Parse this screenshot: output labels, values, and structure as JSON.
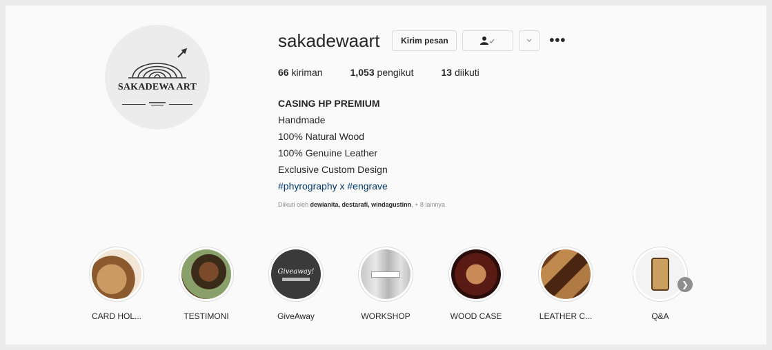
{
  "profile": {
    "username": "sakadewaart",
    "avatar_text": "SAKADEWA ART",
    "buttons": {
      "message": "Kirim pesan",
      "following_icon": "person-check-icon",
      "dropdown_icon": "chevron-down-icon",
      "more": "•••"
    },
    "stats": {
      "posts_count": "66",
      "posts_label": "kiriman",
      "followers_count": "1,053",
      "followers_label": "pengikut",
      "following_count": "13",
      "following_label": "diikuti"
    },
    "bio": {
      "name": "CASING HP PREMIUM",
      "lines": [
        "Handmade",
        "100% Natural Wood",
        "100% Genuine Leather",
        "Exclusive Custom Design"
      ],
      "hashtags": "#phyrography x #engrave"
    },
    "followed_by": {
      "prefix": "Diikuti oleh",
      "names": "dewianita, destarafi, windagustinn",
      "suffix": "+ 8 lainnya"
    }
  },
  "highlights": [
    {
      "label": "CARD HOL..."
    },
    {
      "label": "TESTIMONI"
    },
    {
      "label": "GiveAway"
    },
    {
      "label": "WORKSHOP"
    },
    {
      "label": "WOOD CASE"
    },
    {
      "label": "LEATHER C..."
    },
    {
      "label": "Q&A"
    }
  ],
  "highlight_inner_text": {
    "giveaway": "Giveaway!"
  },
  "colors": {
    "hashtag": "#00376b",
    "border": "#dbdbdb",
    "muted": "#8e8e8e"
  }
}
